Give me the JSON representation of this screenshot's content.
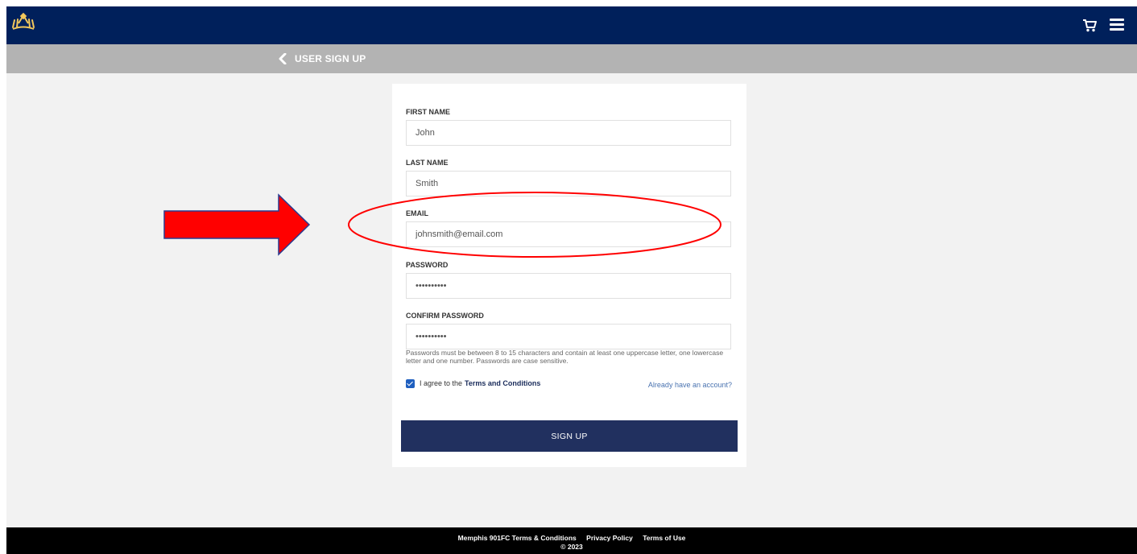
{
  "header": {
    "logo_icon": "crown-icon",
    "cart_icon": "cart-icon",
    "menu_icon": "hamburger-menu-icon",
    "brand_color": "#00205b",
    "accent_color": "#f2c75c"
  },
  "subheader": {
    "back_icon": "chevron-left-icon",
    "title": "USER SIGN UP"
  },
  "form": {
    "first_name": {
      "label": "FIRST NAME",
      "value": "John"
    },
    "last_name": {
      "label": "LAST NAME",
      "value": "Smith"
    },
    "email": {
      "label": "EMAIL",
      "value": "johnsmith@email.com"
    },
    "password": {
      "label": "PASSWORD",
      "value": "••••••••••"
    },
    "confirm_password": {
      "label": "CONFIRM PASSWORD",
      "value": "••••••••••"
    },
    "password_hint": "Passwords must be between 8 to 15 characters and contain at least one uppercase letter, one lowercase letter and one number. Passwords are case sensitive.",
    "agree_text": "I agree to the",
    "terms_link": "Terms and Conditions",
    "agree_checked": true,
    "login_link": "Already have an account?",
    "submit_label": "SIGN UP",
    "submit_color": "#21305f"
  },
  "footer": {
    "links": [
      "Memphis 901FC Terms & Conditions",
      "Privacy Policy",
      "Terms of Use"
    ],
    "copyright": "© 2023"
  },
  "annotations": {
    "arrow_color": "#ff0000",
    "ellipse_color": "#ff0000"
  }
}
